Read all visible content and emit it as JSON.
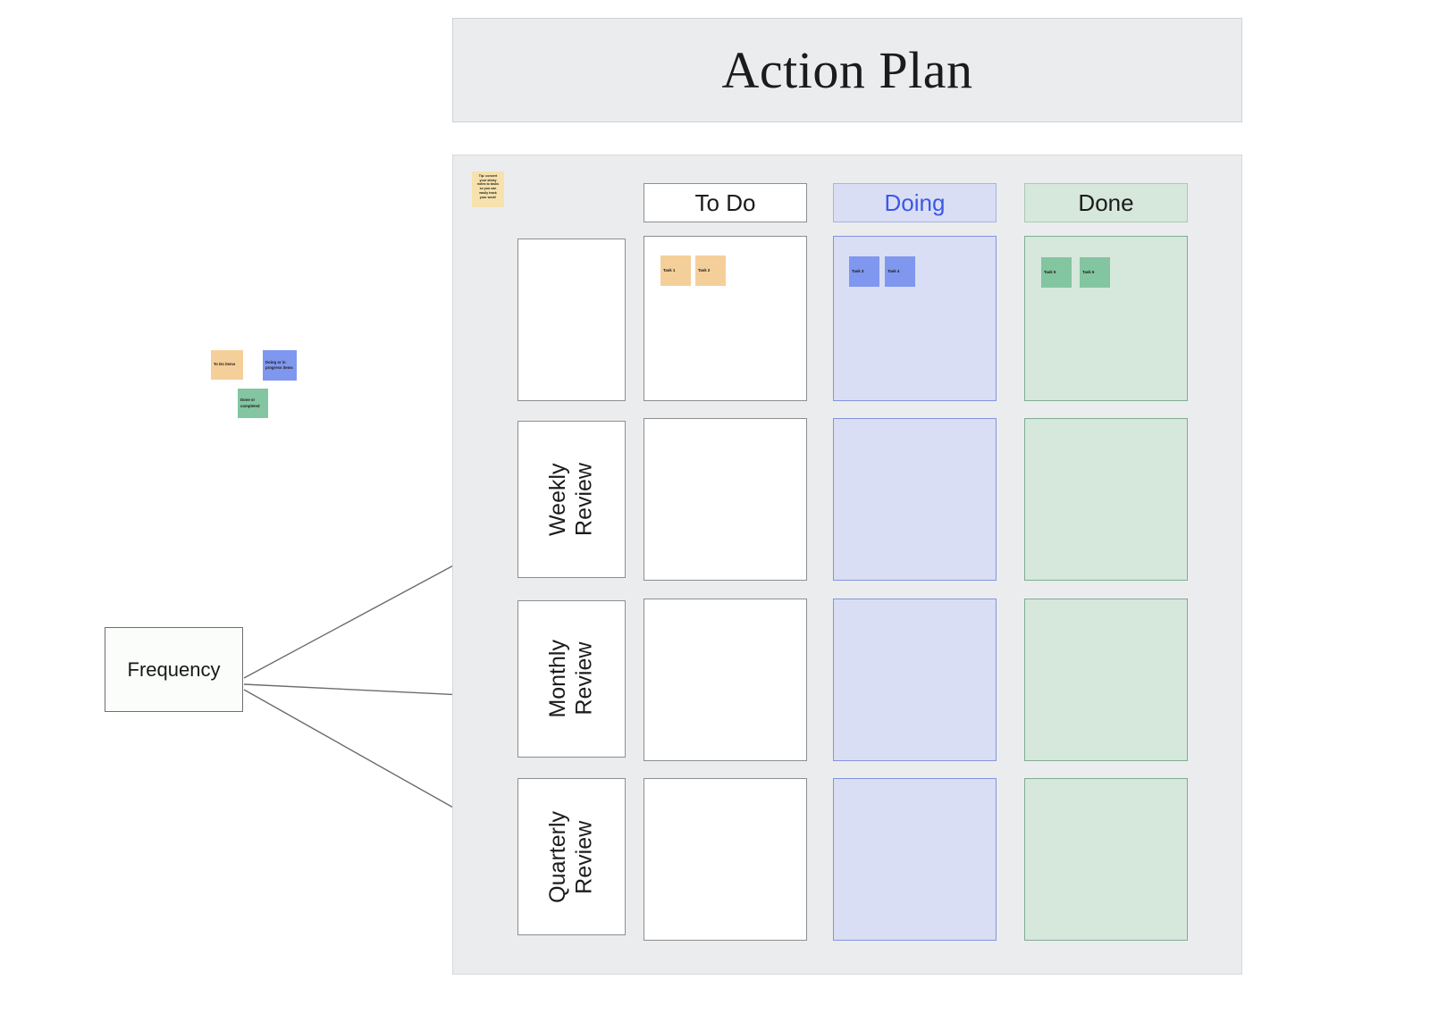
{
  "header": {
    "title": "Action Plan"
  },
  "board": {
    "tip_note": {
      "text": "Tip: convert\nyour sticky\nnotes to tasks\nso you can\neasily track\nyour work!"
    },
    "columns": [
      {
        "id": "todo",
        "label": "To Do"
      },
      {
        "id": "doing",
        "label": "Doing"
      },
      {
        "id": "done",
        "label": "Done"
      }
    ],
    "rows": [
      {
        "id": "row-unlabeled",
        "label": ""
      },
      {
        "id": "row-weekly",
        "label": "Weekly\nReview"
      },
      {
        "id": "row-monthly",
        "label": "Monthly\nReview"
      },
      {
        "id": "row-quarterly",
        "label": "Quarterly\nReview"
      }
    ],
    "tasks": {
      "todo": [
        {
          "label": "Task 1"
        },
        {
          "label": "Task 2"
        }
      ],
      "doing": [
        {
          "label": "Task 3"
        },
        {
          "label": "Task 4"
        }
      ],
      "done": [
        {
          "label": "Task 5"
        },
        {
          "label": "Task 6"
        }
      ]
    }
  },
  "legend": [
    {
      "id": "todo-legend",
      "text": "To Do items"
    },
    {
      "id": "doing-legend",
      "text": "Doing or in\nprogress items"
    },
    {
      "id": "done-legend",
      "text": "Done or\ncompleted"
    }
  ],
  "frequency": {
    "label": "Frequency"
  },
  "colors": {
    "board_bg": "#ebecee",
    "todo_header_bg": "#ffffff",
    "doing_header_bg": "#d9def5",
    "doing_header_text": "#3c58e8",
    "done_header_bg": "#d6e7dc",
    "todo_card": "#f5cf9a",
    "doing_card": "#8097ef",
    "done_card": "#83c5a0",
    "tip_note": "#f7e2ad",
    "connector_line": "#6b6c6e"
  }
}
